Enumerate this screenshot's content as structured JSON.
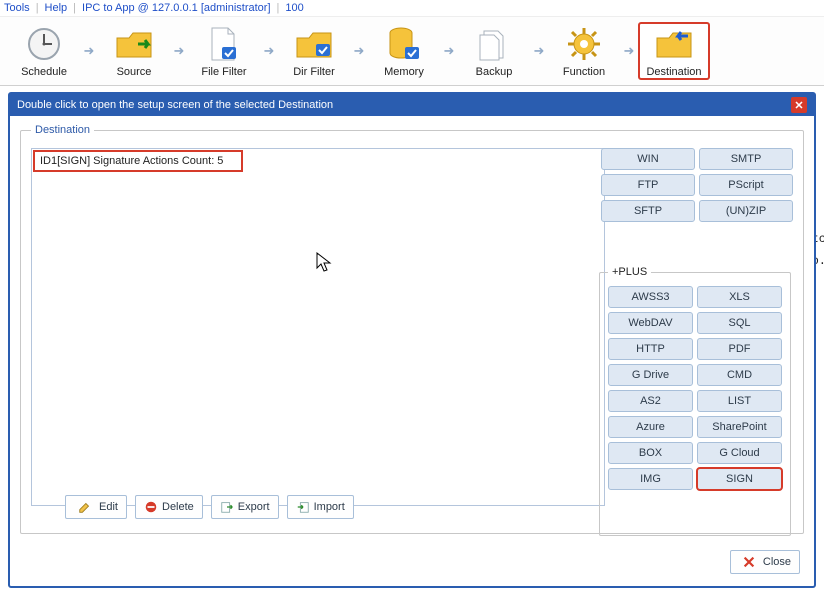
{
  "menu": {
    "tools": "Tools",
    "help": "Help",
    "conn": "IPC to App @ 127.0.0.1 [administrator]",
    "num": "100"
  },
  "toolbar": {
    "schedule": "Schedule",
    "source": "Source",
    "filefilter": "File Filter",
    "dirfilter": "Dir Filter",
    "memory": "Memory",
    "backup": "Backup",
    "function": "Function",
    "destination": "Destination"
  },
  "panel": {
    "title": "Double click to open the setup screen of the selected Destination"
  },
  "groups": {
    "destination": "Destination",
    "plus": "+PLUS"
  },
  "list": {
    "item0": "ID1[SIGN] Signature Actions Count: 5"
  },
  "buttons": {
    "edit": "Edit",
    "delete": "Delete",
    "export": "Export",
    "import": "Import",
    "close": "Close",
    "win": "WIN",
    "smtp": "SMTP",
    "ftp": "FTP",
    "pscript": "PScript",
    "sftp": "SFTP",
    "unzip": "(UN)ZIP",
    "awss3": "AWSS3",
    "xls": "XLS",
    "webdav": "WebDAV",
    "sql": "SQL",
    "http": "HTTP",
    "pdf": "PDF",
    "gdrive": "G Drive",
    "cmd": "CMD",
    "as2": "AS2",
    "liste": "LIST",
    "azure": "Azure",
    "sharepoint": "SharePoint",
    "box": "BOX",
    "gcloud": "G Cloud",
    "img": "IMG",
    "sign": "SIGN"
  },
  "bg": {
    "l1": "itc",
    "l2": "to."
  }
}
